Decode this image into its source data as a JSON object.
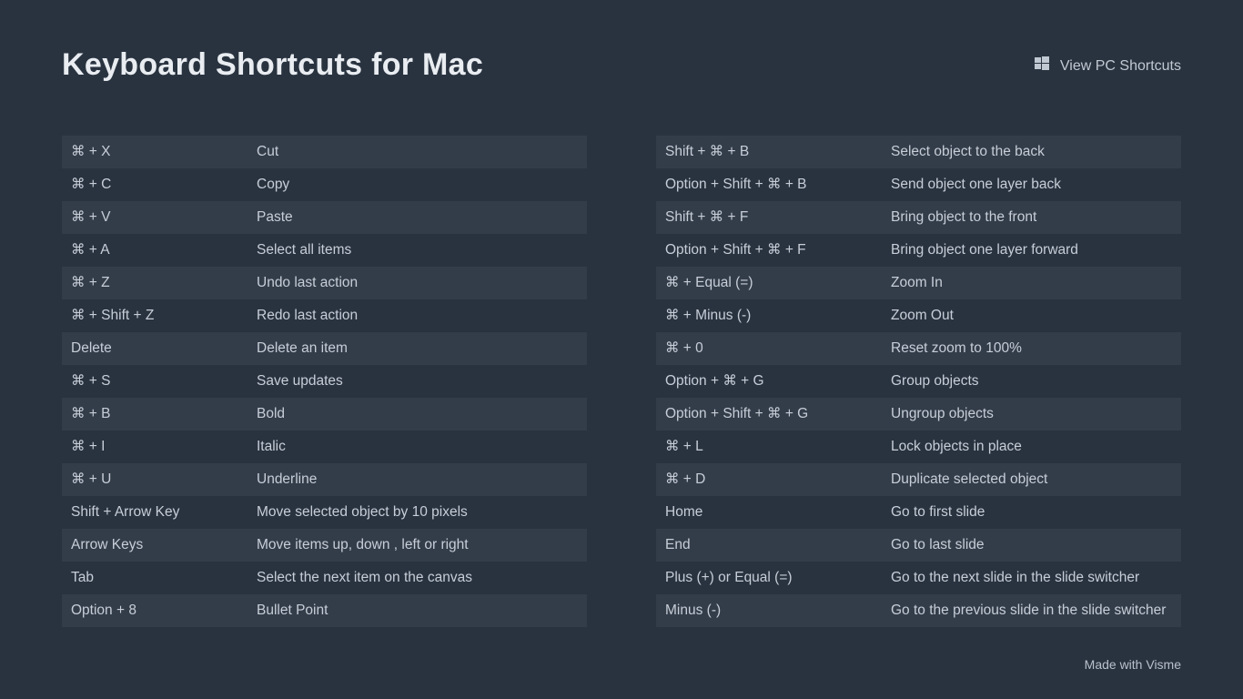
{
  "header": {
    "title": "Keyboard Shortcuts for Mac",
    "view_pc_label": "View PC Shortcuts"
  },
  "footer": "Made with Visme",
  "left": [
    {
      "keys": "⌘ + X",
      "desc": "Cut"
    },
    {
      "keys": "⌘ + C",
      "desc": "Copy"
    },
    {
      "keys": "⌘ + V",
      "desc": "Paste"
    },
    {
      "keys": "⌘ + A",
      "desc": "Select all items"
    },
    {
      "keys": "⌘ + Z",
      "desc": "Undo last action"
    },
    {
      "keys": "⌘ + Shift + Z",
      "desc": "Redo last action"
    },
    {
      "keys": "Delete",
      "desc": "Delete an item"
    },
    {
      "keys": "⌘ + S",
      "desc": "Save updates"
    },
    {
      "keys": "⌘ + B",
      "desc": "Bold"
    },
    {
      "keys": "⌘ + I",
      "desc": "Italic"
    },
    {
      "keys": "⌘ + U",
      "desc": "Underline"
    },
    {
      "keys": "Shift + Arrow Key",
      "desc": "Move selected object by 10 pixels"
    },
    {
      "keys": "Arrow Keys",
      "desc": "Move items up, down , left or right"
    },
    {
      "keys": "Tab",
      "desc": "Select the next item on the canvas"
    },
    {
      "keys": "Option + 8",
      "desc": "Bullet Point"
    }
  ],
  "right": [
    {
      "keys": "Shift + ⌘ + B",
      "desc": "Select object to the back"
    },
    {
      "keys": "Option + Shift + ⌘ + B",
      "desc": "Send object one layer back"
    },
    {
      "keys": "Shift + ⌘ + F",
      "desc": "Bring object to the front"
    },
    {
      "keys": "Option + Shift + ⌘ + F",
      "desc": "Bring object one layer forward"
    },
    {
      "keys": "⌘ + Equal (=)",
      "desc": "Zoom In"
    },
    {
      "keys": "⌘ + Minus (-)",
      "desc": "Zoom Out"
    },
    {
      "keys": "⌘ + 0",
      "desc": "Reset zoom to 100%"
    },
    {
      "keys": "Option + ⌘ + G",
      "desc": "Group objects"
    },
    {
      "keys": "Option + Shift + ⌘ + G",
      "desc": "Ungroup objects"
    },
    {
      "keys": "⌘ + L",
      "desc": "Lock objects in place"
    },
    {
      "keys": "⌘ + D",
      "desc": "Duplicate selected object"
    },
    {
      "keys": "Home",
      "desc": "Go to first slide"
    },
    {
      "keys": "End",
      "desc": "Go to last slide"
    },
    {
      "keys": "Plus (+) or Equal (=)",
      "desc": "Go to the next slide in the slide switcher"
    },
    {
      "keys": "Minus (-)",
      "desc": "Go to the previous slide in the slide switcher"
    }
  ]
}
